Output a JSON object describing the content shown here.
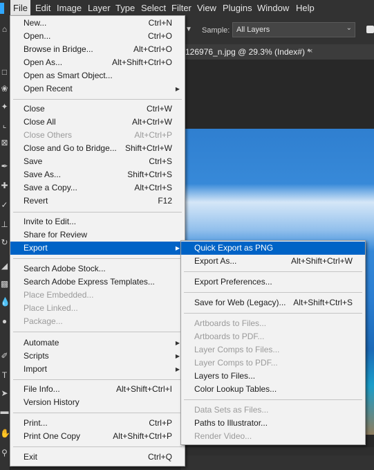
{
  "menubar": {
    "items": [
      {
        "label": "File",
        "active": true
      },
      {
        "label": "Edit"
      },
      {
        "label": "Image"
      },
      {
        "label": "Layer"
      },
      {
        "label": "Type"
      },
      {
        "label": "Select"
      },
      {
        "label": "Filter"
      },
      {
        "label": "View"
      },
      {
        "label": "Plugins"
      },
      {
        "label": "Window"
      },
      {
        "label": "Help"
      }
    ]
  },
  "options_bar": {
    "sample_label": "Sample:",
    "sample_value": "All Layers",
    "sample_checked": true
  },
  "document": {
    "tab_title": "126976_n.jpg @ 29.3% (Index#) *",
    "tab_close": "×"
  },
  "file_menu": {
    "items": [
      {
        "label": "New...",
        "shortcut": "Ctrl+N"
      },
      {
        "label": "Open...",
        "shortcut": "Ctrl+O"
      },
      {
        "label": "Browse in Bridge...",
        "shortcut": "Alt+Ctrl+O"
      },
      {
        "label": "Open As...",
        "shortcut": "Alt+Shift+Ctrl+O"
      },
      {
        "label": "Open as Smart Object...",
        "shortcut": ""
      },
      {
        "label": "Open Recent",
        "shortcut": "",
        "submenu": true
      },
      {
        "label": "Close",
        "shortcut": "Ctrl+W"
      },
      {
        "label": "Close All",
        "shortcut": "Alt+Ctrl+W"
      },
      {
        "label": "Close Others",
        "shortcut": "Alt+Ctrl+P",
        "disabled": true
      },
      {
        "label": "Close and Go to Bridge...",
        "shortcut": "Shift+Ctrl+W"
      },
      {
        "label": "Save",
        "shortcut": "Ctrl+S"
      },
      {
        "label": "Save As...",
        "shortcut": "Shift+Ctrl+S"
      },
      {
        "label": "Save a Copy...",
        "shortcut": "Alt+Ctrl+S"
      },
      {
        "label": "Revert",
        "shortcut": "F12"
      },
      {
        "label": "Invite to Edit...",
        "shortcut": ""
      },
      {
        "label": "Share for Review",
        "shortcut": ""
      },
      {
        "label": "Export",
        "shortcut": "",
        "submenu": true,
        "highlighted": true
      },
      {
        "label": "Search Adobe Stock...",
        "shortcut": ""
      },
      {
        "label": "Search Adobe Express Templates...",
        "shortcut": ""
      },
      {
        "label": "Place Embedded...",
        "shortcut": "",
        "disabled": true
      },
      {
        "label": "Place Linked...",
        "shortcut": "",
        "disabled": true
      },
      {
        "label": "Package...",
        "shortcut": "",
        "disabled": true
      },
      {
        "label": "Automate",
        "shortcut": "",
        "submenu": true
      },
      {
        "label": "Scripts",
        "shortcut": "",
        "submenu": true
      },
      {
        "label": "Import",
        "shortcut": "",
        "submenu": true
      },
      {
        "label": "File Info...",
        "shortcut": "Alt+Shift+Ctrl+I"
      },
      {
        "label": "Version History",
        "shortcut": ""
      },
      {
        "label": "Print...",
        "shortcut": "Ctrl+P"
      },
      {
        "label": "Print One Copy",
        "shortcut": "Alt+Shift+Ctrl+P"
      },
      {
        "label": "Exit",
        "shortcut": "Ctrl+Q"
      }
    ]
  },
  "export_menu": {
    "items": [
      {
        "label": "Quick Export as PNG",
        "shortcut": "",
        "highlighted": true
      },
      {
        "label": "Export As...",
        "shortcut": "Alt+Shift+Ctrl+W"
      },
      {
        "label": "Export Preferences...",
        "shortcut": ""
      },
      {
        "label": "Save for Web (Legacy)...",
        "shortcut": "Alt+Shift+Ctrl+S"
      },
      {
        "label": "Artboards to Files...",
        "shortcut": "",
        "disabled": true
      },
      {
        "label": "Artboards to PDF...",
        "shortcut": "",
        "disabled": true
      },
      {
        "label": "Layer Comps to Files...",
        "shortcut": "",
        "disabled": true
      },
      {
        "label": "Layer Comps to PDF...",
        "shortcut": "",
        "disabled": true
      },
      {
        "label": "Layers to Files...",
        "shortcut": ""
      },
      {
        "label": "Color Lookup Tables...",
        "shortcut": ""
      },
      {
        "label": "Data Sets as Files...",
        "shortcut": "",
        "disabled": true
      },
      {
        "label": "Paths to Illustrator...",
        "shortcut": ""
      },
      {
        "label": "Render Video...",
        "shortcut": "",
        "disabled": true
      }
    ]
  },
  "toolbar": {
    "tools": [
      "home-icon",
      "marquee-icon",
      "lasso-icon",
      "magic-wand-icon",
      "crop-icon",
      "frame-icon",
      "eyedropper-icon",
      "healing-brush-icon",
      "brush-icon",
      "clone-stamp-icon",
      "history-brush-icon",
      "eraser-icon",
      "gradient-icon",
      "blur-icon",
      "dodge-icon",
      "pen-icon",
      "type-icon",
      "path-select-icon",
      "shape-icon",
      "hand-icon",
      "zoom-icon"
    ]
  },
  "colors": {
    "menu_bg": "#f2f2f2",
    "highlight": "#0063c6",
    "app_chrome": "#323232",
    "disabled_text": "#9a9a9a"
  }
}
